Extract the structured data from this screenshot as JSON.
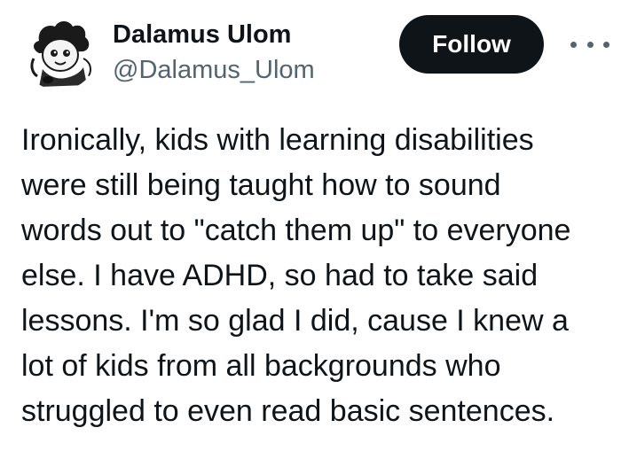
{
  "author": {
    "display_name": "Dalamus Ulom",
    "handle": "@Dalamus_Ulom",
    "avatar_icon": "cartoon-character-avatar-icon"
  },
  "actions": {
    "follow_label": "Follow",
    "more_icon": "more-options-icon"
  },
  "tweet": {
    "text": "Ironically, kids with learning disabilities\nwere still being taught how to sound\nwords out to \"catch them up\" to everyone\nelse. I have ADHD, so had to take said\nlessons. I'm so glad I did, cause I knew a\nlot of kids from all backgrounds who\nstruggled to even read basic sentences."
  },
  "colors": {
    "text_primary": "#0f1419",
    "text_secondary": "#536471",
    "button_bg": "#0f1419",
    "button_text": "#ffffff",
    "background": "#ffffff"
  }
}
